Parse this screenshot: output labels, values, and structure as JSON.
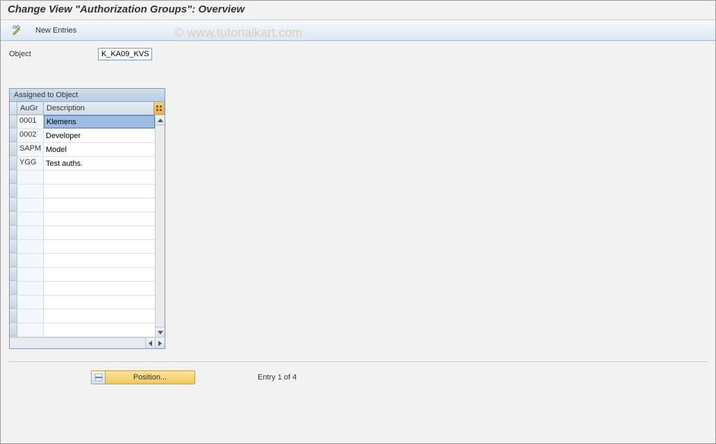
{
  "title": "Change View \"Authorization Groups\": Overview",
  "toolbar": {
    "new_entries_label": "New Entries"
  },
  "form": {
    "object_label": "Object",
    "object_value": "K_KA09_KVS"
  },
  "table": {
    "panel_title": "Assigned to Object",
    "columns": {
      "augr": "AuGr",
      "description": "Description"
    },
    "rows": [
      {
        "augr": "0001",
        "description": "Klemens",
        "selected": true
      },
      {
        "augr": "0002",
        "description": "Developer",
        "selected": false
      },
      {
        "augr": "SAPM",
        "description": "Model",
        "selected": false
      },
      {
        "augr": "YGG",
        "description": "Test auths.",
        "selected": false
      },
      {
        "augr": "",
        "description": "",
        "selected": false
      },
      {
        "augr": "",
        "description": "",
        "selected": false
      },
      {
        "augr": "",
        "description": "",
        "selected": false
      },
      {
        "augr": "",
        "description": "",
        "selected": false
      },
      {
        "augr": "",
        "description": "",
        "selected": false
      },
      {
        "augr": "",
        "description": "",
        "selected": false
      },
      {
        "augr": "",
        "description": "",
        "selected": false
      },
      {
        "augr": "",
        "description": "",
        "selected": false
      },
      {
        "augr": "",
        "description": "",
        "selected": false
      },
      {
        "augr": "",
        "description": "",
        "selected": false
      },
      {
        "augr": "",
        "description": "",
        "selected": false
      },
      {
        "augr": "",
        "description": "",
        "selected": false
      }
    ]
  },
  "footer": {
    "position_label": "Position...",
    "entry_status": "Entry 1 of 4"
  },
  "watermark": "© www.tutorialkart.com"
}
